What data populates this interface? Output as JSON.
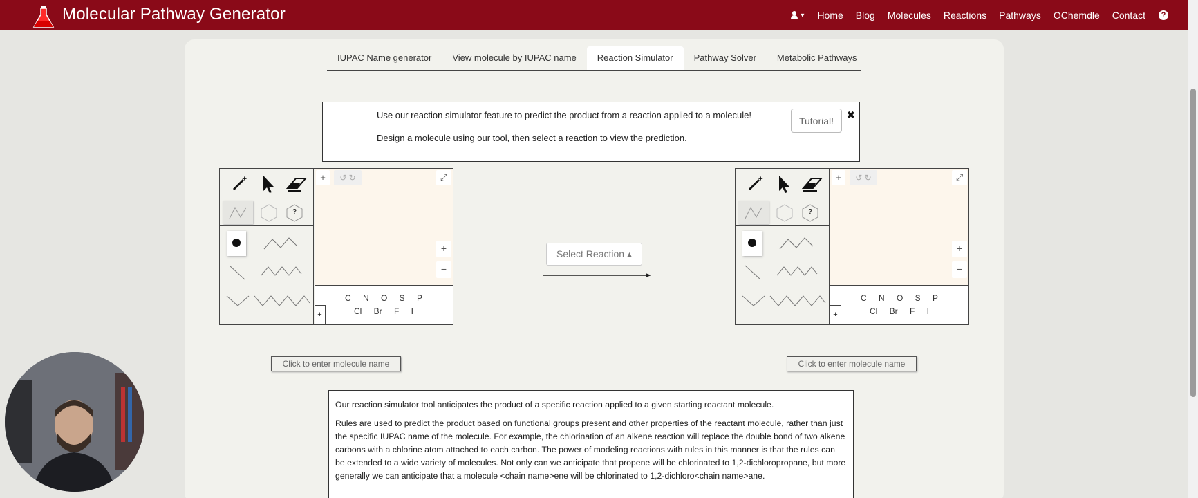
{
  "navbar": {
    "brand": "Molecular Pathway Generator",
    "items": [
      "Home",
      "Blog",
      "Molecules",
      "Reactions",
      "Pathways",
      "OChemdle",
      "Contact"
    ],
    "help_glyph": "?",
    "user_caret": "▾"
  },
  "tabs": [
    {
      "label": "IUPAC Name generator"
    },
    {
      "label": "View molecule by IUPAC name"
    },
    {
      "label": "Reaction Simulator"
    },
    {
      "label": "Pathway Solver"
    },
    {
      "label": "Metabolic Pathways"
    }
  ],
  "info": {
    "line1": "Use our reaction simulator feature to predict the product from a reaction applied to a molecule!",
    "line2": "Design a molecule using our tool, then select a reaction to view the prediction.",
    "tutorial_label": "Tutorial!",
    "close_glyph": "✖"
  },
  "editor": {
    "atoms_row1": "C N O S P",
    "atoms_row2": "Cl Br F I",
    "add_glyph": "+",
    "plus_glyph": "+",
    "undo_glyph": "↺ ↻",
    "expand_glyph": "⤢",
    "zoom_in": "+",
    "zoom_out": "−",
    "unknown_glyph": "?"
  },
  "name_button_label": "Click to enter molecule name",
  "select_reaction_label": "Select Reaction ▴",
  "description": {
    "p1": "Our reaction simulator tool anticipates the product of a specific reaction applied to a given starting reactant molecule.",
    "p2": "Rules are used to predict the product based on functional groups present and other properties of the reactant molecule, rather than just the specific IUPAC name of the molecule. For example, the chlorination of an alkene reaction will replace the double bond of two alkene carbons with a chlorine atom attached to each carbon. The power of modeling reactions with rules in this manner is that the rules can be extended to a wide variety of molecules. Not only can we anticipate that propene will be chlorinated to 1,2-dichloropropane, but more generally we can anticipate that a molecule <chain name>ene will be chlorinated to 1,2-dichloro<chain name>ane."
  },
  "colors": {
    "navbar": "#8a0a18",
    "canvas": "#fdf6ec",
    "panel": "#f2f2ed"
  }
}
